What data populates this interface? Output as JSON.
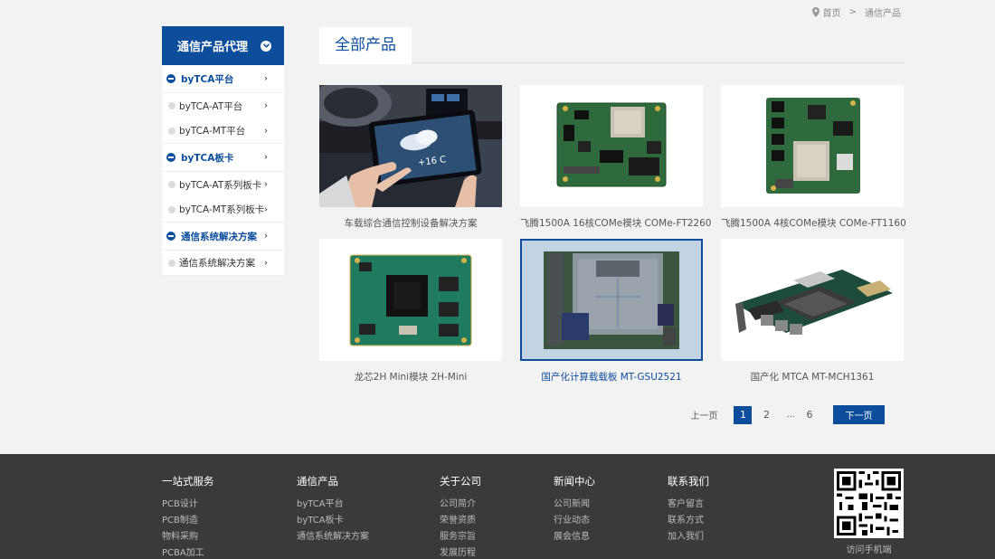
{
  "breadcrumb": {
    "home": "首页",
    "separator": ">",
    "current": "通信产品"
  },
  "sidebar": {
    "title": "通信产品代理",
    "items": [
      {
        "label": "byTCA平台",
        "type": "cat"
      },
      {
        "label": "byTCA-AT平台",
        "type": "sub"
      },
      {
        "label": "byTCA-MT平台",
        "type": "sub"
      },
      {
        "label": "byTCA板卡",
        "type": "cat"
      },
      {
        "label": "byTCA-AT系列板卡",
        "type": "sub"
      },
      {
        "label": "byTCA-MT系列板卡",
        "type": "sub"
      },
      {
        "label": "通信系统解决方案",
        "type": "cat"
      },
      {
        "label": "通信系统解决方案",
        "type": "sub"
      }
    ]
  },
  "main": {
    "title": "全部产品"
  },
  "products": [
    {
      "caption": "车载综合通信控制设备解决方案"
    },
    {
      "caption": "飞腾1500A 16核COMe模块 COMe-FT2260"
    },
    {
      "caption": "飞腾1500A 4核COMe模块 COMe-FT1160"
    },
    {
      "caption": "龙芯2H Mini模块 2H-Mini"
    },
    {
      "caption": "国产化计算载载板 MT-GSU2521",
      "active": true
    },
    {
      "caption": "国产化 MTCA MT-MCH1361"
    }
  ],
  "tablet_text": "+16 C",
  "pagination": {
    "prev": "上一页",
    "pages": [
      "1",
      "2",
      "...",
      "6"
    ],
    "current": "1",
    "next": "下一页"
  },
  "footer": {
    "columns": [
      {
        "title": "一站式服务",
        "links": [
          "PCB设计",
          "PCB制造",
          "物料采购",
          "PCBA加工"
        ]
      },
      {
        "title": "通信产品",
        "links": [
          "byTCA平台",
          "byTCA板卡",
          "通信系统解决方案"
        ]
      },
      {
        "title": "关于公司",
        "links": [
          "公司简介",
          "荣誉资质",
          "服务宗旨",
          "发展历程"
        ]
      },
      {
        "title": "新闻中心",
        "links": [
          "公司新闻",
          "行业动态",
          "展会信息"
        ]
      },
      {
        "title": "联系我们",
        "links": [
          "客户留言",
          "联系方式",
          "加入我们"
        ]
      }
    ],
    "qr_caption": "访问手机端"
  },
  "colors": {
    "brand": "#0d4e9c",
    "footer_bg": "#3a3a3a",
    "page_bg": "#f2f2f2"
  }
}
